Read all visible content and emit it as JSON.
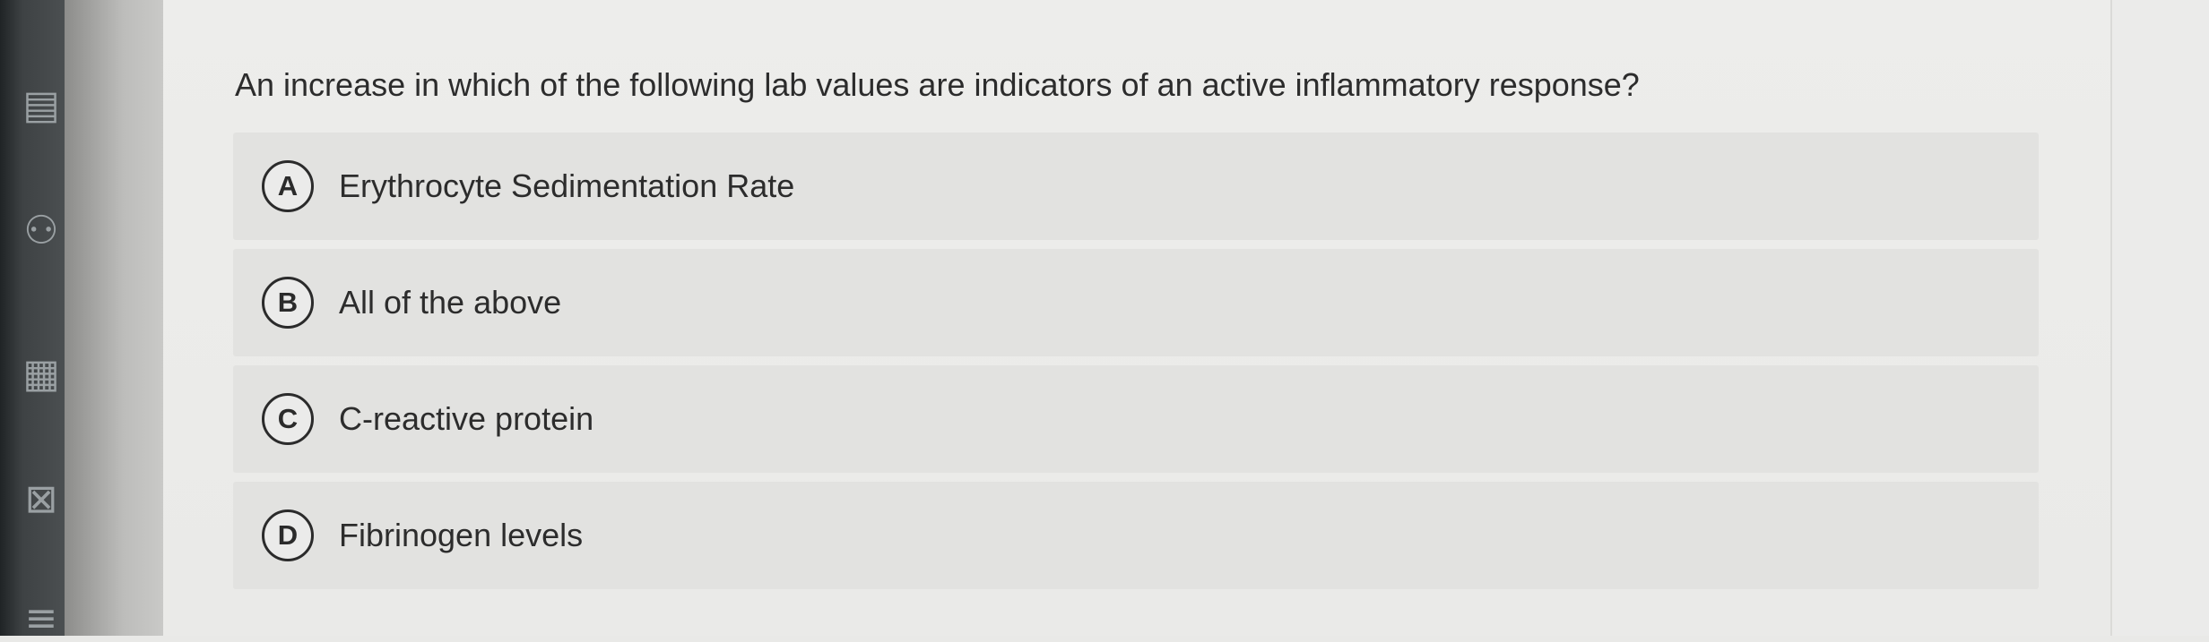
{
  "sidebar": {
    "icons": [
      "book-icon",
      "people-icon",
      "calendar-icon",
      "mail-icon",
      "list-icon"
    ]
  },
  "question": {
    "text": "An increase in which of the following lab values are indicators of an active inflammatory response?"
  },
  "options": [
    {
      "letter": "A",
      "text": "Erythrocyte Sedimentation Rate"
    },
    {
      "letter": "B",
      "text": "All of the above"
    },
    {
      "letter": "C",
      "text": "C-reactive protein"
    },
    {
      "letter": "D",
      "text": "Fibrinogen levels"
    }
  ]
}
